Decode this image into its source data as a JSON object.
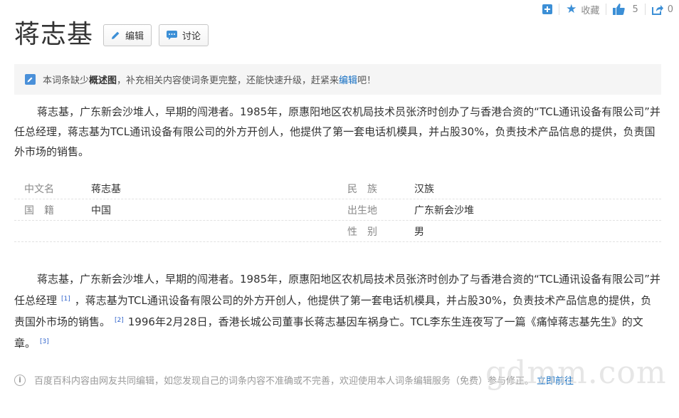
{
  "toolbar": {
    "collect_label": "收藏",
    "like_count": "5",
    "share_count": "0",
    "icons": {
      "add": "plus-square-icon",
      "collect": "star-icon",
      "like": "thumbs-up-icon",
      "share": "share-icon"
    },
    "accent_color": "#3c8fd6"
  },
  "header": {
    "title": "蒋志基",
    "edit_label": "编辑",
    "discuss_label": "讨论"
  },
  "tip": {
    "prefix": "本词条缺少",
    "bold": "概述图",
    "middle": "，补充相关内容使词条更完整，还能快速升级，赶紧来",
    "link": "编辑",
    "suffix": "吧！"
  },
  "summary": "蒋志基，广东新会沙堆人，早期的闯港者。1985年，原惠阳地区农机局技术员张济时创办了与香港合资的“TCL通讯设备有限公司”并任总经理，蒋志基为TCL通讯设备有限公司的外方开创人，他提供了第一套电话机模具，并占股30%，负责技术产品信息的提供，负责国外市场的销售。",
  "basic_info": {
    "rows": [
      [
        {
          "name": "中文名",
          "value": "蒋志基"
        },
        {
          "name": "民　族",
          "value": "汉族"
        }
      ],
      [
        {
          "name": "国　籍",
          "value": "中国"
        },
        {
          "name": "出生地",
          "value": "广东新会沙堆"
        }
      ],
      [
        {
          "name": "",
          "value": ""
        },
        {
          "name": "性　别",
          "value": "男"
        }
      ]
    ]
  },
  "body": {
    "part1": "蒋志基，广东新会沙堆人，早期的闯港者。1985年，原惠阳地区农机局技术员张济时创办了与香港合资的“TCL通讯设备有限公司”并任总经理",
    "ref1": "[1]",
    "part2": "，蒋志基为TCL通讯设备有限公司的外方开创人，他提供了第一套电话机模具，并占股30%，负责技术产品信息的提供，负责国外市场的销售。",
    "ref2": "[2]",
    "part3": "1996年2月28日，香港长城公司董事长蒋志基因车祸身亡。TCL李东生连夜写了一篇《痛悼蒋志基先生》的文章。",
    "ref3": "[3]"
  },
  "footer": {
    "text": "百度百科内容由网友共同编辑，如您发现自己的词条内容不准确或不完善，欢迎使用本人词条编辑服务（免费）参与修正。",
    "link": "立即前往"
  },
  "watermark": "gdmm.com"
}
